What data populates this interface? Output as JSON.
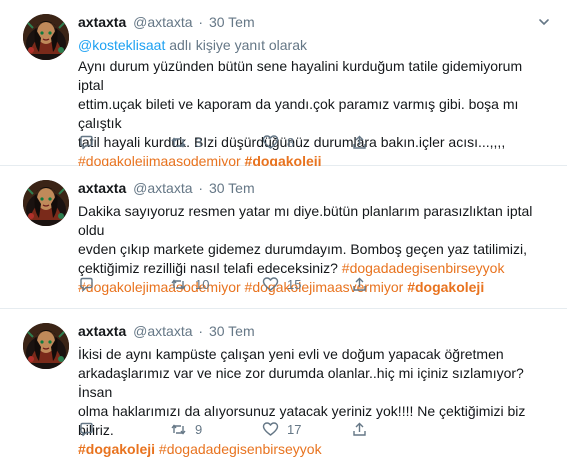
{
  "tweets": [
    {
      "name": "axtaxta",
      "handle": "@axtaxta",
      "date": "30 Tem",
      "reply_user": "@kosteklisaat",
      "reply_text": "adlı kişiye yanıt olarak",
      "lines": [
        "Aynı durum yüzünden bütün sene hayalini kurduğum tatile gidemiyorum iptal",
        "ettim.uçak bileti ve kaporam da yandı.çok paramız varmış gibi. boşa mı çalıştık",
        "tatil hayali kurduk. BIzi düşürdüğünüz durumlara bakın.içler acısı...,,,,"
      ],
      "tags": [
        "#dogakolejimaasodemiyor",
        "#dogakoleji"
      ],
      "retweets": "3",
      "likes": "8"
    },
    {
      "name": "axtaxta",
      "handle": "@axtaxta",
      "date": "30 Tem",
      "lines": [
        "Dakika sayıyoruz resmen yatar mı diye.bütün planlarım parasızlıktan iptal oldu",
        "evden çıkıp markete gidemez durumdayım. Bomboş geçen yaz tatilimizi,",
        "çektiğimiz rezilliği nasıl telafi edeceksiniz?"
      ],
      "inline_tag": "#dogadadegisenbirseyyok",
      "tags": [
        "#dogakolejimaasodemiyor",
        "#dogakolejimaasvermiyor",
        "#dogakoleji"
      ],
      "retweets": "10",
      "likes": "15"
    },
    {
      "name": "axtaxta",
      "handle": "@axtaxta",
      "date": "30 Tem",
      "lines": [
        "İkisi de aynı kampüste çalışan yeni evli ve doğum yapacak  öğretmen",
        "arkadaşlarımız var  ve nice zor durumda olanlar..hiç mi içiniz sızlamıyor? İnsan",
        "olma haklarımızı da alıyorsunuz yatacak yeriniz yok!!!! Ne çektiğimizi biz biliriz."
      ],
      "tags": [
        "#dogakoleji",
        "#dogadadegisenbirseyyok"
      ],
      "retweets": "9",
      "likes": "17"
    }
  ],
  "colors": {
    "hashtag": "#e8731f",
    "mention": "#1da1f2",
    "muted": "#657786",
    "text": "#14171a"
  },
  "icons": [
    "chevron-down-icon",
    "reply-icon",
    "retweet-icon",
    "like-icon",
    "share-icon"
  ]
}
